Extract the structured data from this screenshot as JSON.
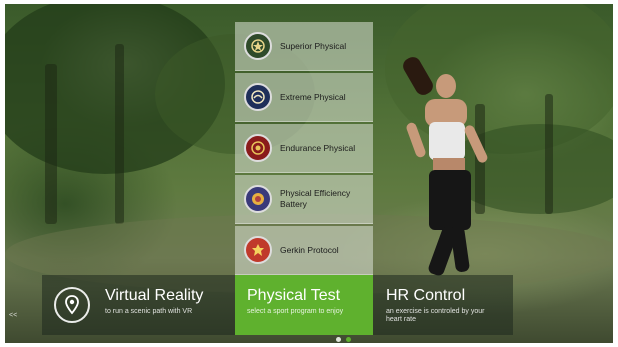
{
  "menu": {
    "items": [
      {
        "label": "Superior Physical",
        "icon": "army-seal-icon",
        "color": "#2f4a2a"
      },
      {
        "label": "Extreme Physical",
        "icon": "navy-seal-icon",
        "color": "#1f2f5a"
      },
      {
        "label": "Endurance Physical",
        "icon": "marine-corps-seal-icon",
        "color": "#8a1b1b"
      },
      {
        "label": "Physical Efficiency Battery",
        "icon": "police-seal-icon",
        "color": "#3a3a7a"
      },
      {
        "label": "Gerkin Protocol",
        "icon": "fire-department-seal-icon",
        "color": "#c0392b"
      }
    ]
  },
  "bottom_bar": {
    "virtual_reality": {
      "title": "Virtual Reality",
      "subtitle": "to run a scenic path with VR",
      "icon": "location-pin-icon"
    },
    "physical_test": {
      "title": "Physical Test",
      "subtitle": "select a sport program to enjoy"
    },
    "hr_control": {
      "title": "HR Control",
      "subtitle": "an exercise is controled by your heart rate"
    }
  },
  "nav": {
    "back_label": "<<"
  },
  "pagination": {
    "count": 2,
    "active": 1
  },
  "colors": {
    "accent": "#5fb12e",
    "panel": "#dce4d7"
  }
}
